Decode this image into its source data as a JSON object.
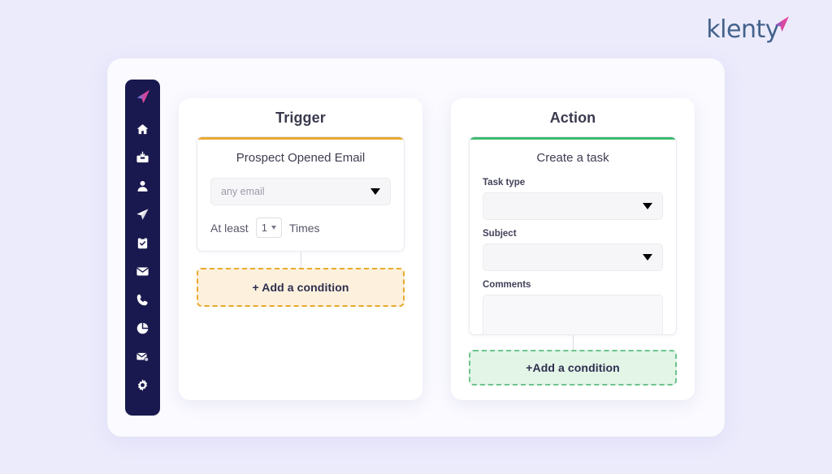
{
  "brand": {
    "name": "klenty",
    "mark_icon": "paper-plane-icon"
  },
  "sidebar": {
    "logo_icon": "klenty-paper-plane-logo",
    "items": [
      {
        "icon": "home-icon",
        "label": "Home"
      },
      {
        "icon": "inbox-download-icon",
        "label": "Inbox"
      },
      {
        "icon": "person-icon",
        "label": "Prospects"
      },
      {
        "icon": "send-plane-icon",
        "label": "Cadences"
      },
      {
        "icon": "clipboard-check-icon",
        "label": "Tasks"
      },
      {
        "icon": "envelope-icon",
        "label": "Emails"
      },
      {
        "icon": "phone-icon",
        "label": "Calls"
      },
      {
        "icon": "pie-chart-icon",
        "label": "Reports"
      },
      {
        "icon": "envelope-badge-icon",
        "label": "Notifications"
      },
      {
        "icon": "gear-icon",
        "label": "Settings"
      }
    ]
  },
  "colors": {
    "page_background": "#ecebfc",
    "panel_background": "#fafaff",
    "sidebar_background": "#19194f",
    "trigger_accent": "#eaa92e",
    "action_accent": "#3cba6e",
    "condition_orange_fill": "#fdf1dd",
    "condition_green_fill": "#e2f5e7",
    "brand_text": "#43628c"
  },
  "trigger": {
    "title": "Trigger",
    "node_heading": "Prospect Opened Email",
    "email_select": {
      "value": "any email",
      "placeholder": "any email",
      "caret_icon": "chevron-down-icon"
    },
    "at_least_prefix": "At least",
    "count_value": "1",
    "count_caret_icon": "chevron-down-icon",
    "times_suffix": "Times",
    "add_condition_label": "+ Add a condition"
  },
  "action": {
    "title": "Action",
    "node_heading": "Create a task",
    "fields": [
      {
        "label": "Task type",
        "value": "",
        "type": "select",
        "caret_icon": "chevron-down-icon"
      },
      {
        "label": "Subject",
        "value": "",
        "type": "select",
        "caret_icon": "chevron-down-icon"
      },
      {
        "label": "Comments",
        "value": "",
        "type": "textarea"
      }
    ],
    "add_condition_label": "+Add a condition"
  }
}
